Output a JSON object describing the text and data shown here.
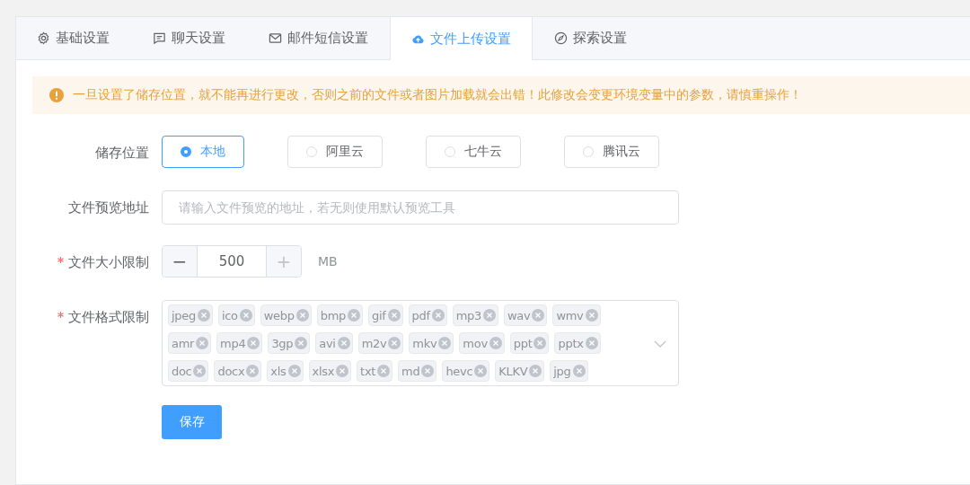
{
  "tabs": [
    {
      "label": "基础设置",
      "selected": false
    },
    {
      "label": "聊天设置",
      "selected": false
    },
    {
      "label": "邮件短信设置",
      "selected": false
    },
    {
      "label": "文件上传设置",
      "selected": true
    },
    {
      "label": "探索设置",
      "selected": false
    }
  ],
  "alert": {
    "text": "一旦设置了储存位置，就不能再进行更改，否则之前的文件或者图片加载就会出错！此修改会变更环境变量中的参数，请慎重操作！"
  },
  "form": {
    "storage": {
      "label": "储存位置",
      "required": false,
      "options": [
        {
          "label": "本地",
          "selected": true
        },
        {
          "label": "阿里云",
          "selected": false
        },
        {
          "label": "七牛云",
          "selected": false
        },
        {
          "label": "腾讯云",
          "selected": false
        }
      ]
    },
    "preview": {
      "label": "文件预览地址",
      "required": false,
      "placeholder": "请输入文件预览的地址，若无则使用默认预览工具"
    },
    "size": {
      "label": "文件大小限制",
      "required": true,
      "minus": "−",
      "value": "500",
      "plus": "+",
      "unit": "MB"
    },
    "formats": {
      "label": "文件格式限制",
      "required": true,
      "tags": [
        "jpeg",
        "ico",
        "webp",
        "bmp",
        "gif",
        "pdf",
        "mp3",
        "wav",
        "wmv",
        "amr",
        "mp4",
        "3gp",
        "avi",
        "m2v",
        "mkv",
        "mov",
        "ppt",
        "pptx",
        "doc",
        "docx",
        "xls",
        "xlsx",
        "txt",
        "md",
        "hevc",
        "KLKV",
        "jpg"
      ]
    },
    "save": "保存"
  }
}
